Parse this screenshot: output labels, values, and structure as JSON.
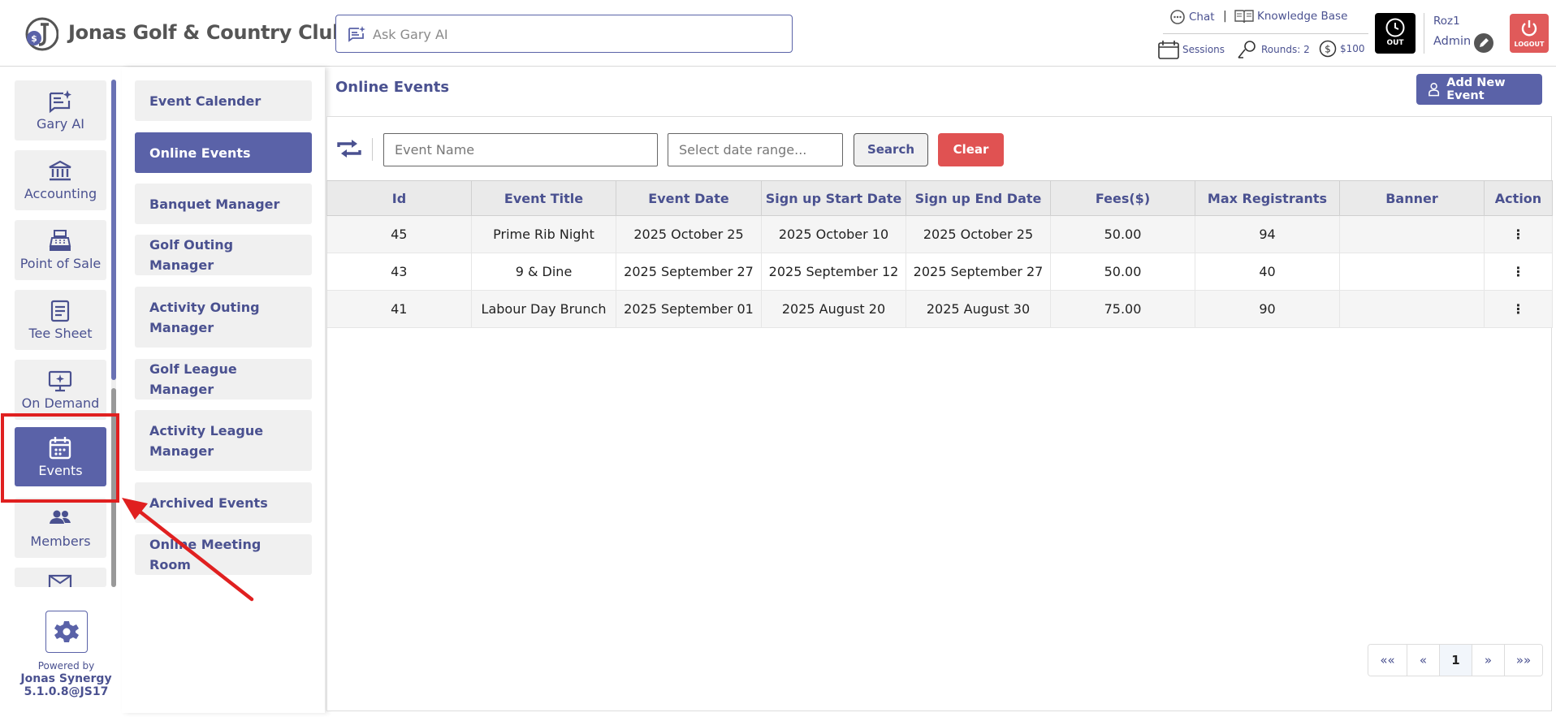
{
  "header": {
    "club_name": "Jonas Golf & Country Club",
    "ask_placeholder": "Ask Gary AI",
    "chat_label": "Chat",
    "separator": "|",
    "knowledge_label": "Knowledge Base",
    "sessions_label": "Sessions",
    "rounds_label": "Rounds: 2",
    "balance_label": "$100",
    "clock_label": "OUT",
    "user_name": "Roz1",
    "user_role": "Admin",
    "logout_label": "LOGOUT"
  },
  "leftnav": {
    "items": [
      {
        "label": "Gary AI",
        "icon": "gary-ai-icon"
      },
      {
        "label": "Accounting",
        "icon": "bank-icon"
      },
      {
        "label": "Point of Sale",
        "icon": "cash-register-icon"
      },
      {
        "label": "Tee Sheet",
        "icon": "document-icon"
      },
      {
        "label": "On Demand",
        "icon": "monitor-sparkle-icon"
      },
      {
        "label": "Events",
        "icon": "calendar-icon",
        "active": true
      },
      {
        "label": "Members",
        "icon": "members-icon"
      }
    ],
    "powered_by": "Powered by",
    "brand": "Jonas Synergy",
    "version": "5.1.0.8@JS17"
  },
  "submenu": {
    "items": [
      {
        "label": "Event Calender"
      },
      {
        "label": "Online Events",
        "active": true
      },
      {
        "label": "Banquet Manager"
      },
      {
        "label": "Golf Outing Manager"
      },
      {
        "label": "Activity Outing Manager"
      },
      {
        "label": "Golf League Manager"
      },
      {
        "label": "Activity League Manager"
      },
      {
        "label": "Archived Events"
      },
      {
        "label": "Online Meeting Room"
      }
    ]
  },
  "main": {
    "title": "Online Events",
    "add_button": "Add New Event",
    "filters": {
      "event_name_placeholder": "Event Name",
      "date_range_placeholder": "Select date range...",
      "search_label": "Search",
      "clear_label": "Clear"
    },
    "table": {
      "columns": [
        "Id",
        "Event Title",
        "Event Date",
        "Sign up Start Date",
        "Sign up End Date",
        "Fees($)",
        "Max Registrants",
        "Banner",
        "Action"
      ],
      "rows": [
        [
          "45",
          "Prime Rib Night",
          "2025 October 25",
          "2025 October 10",
          "2025 October 25",
          "50.00",
          "94",
          "",
          "⋮"
        ],
        [
          "43",
          "9 & Dine",
          "2025 September 27",
          "2025 September 12",
          "2025 September 27",
          "50.00",
          "40",
          "",
          "⋮"
        ],
        [
          "41",
          "Labour Day Brunch",
          "2025 September 01",
          "2025 August 20",
          "2025 August 30",
          "75.00",
          "90",
          "",
          "⋮"
        ]
      ]
    },
    "pagination": {
      "first": "««",
      "prev": "«",
      "current": "1",
      "next": "»",
      "last": "»»"
    }
  },
  "colors": {
    "accent": "#5a62a8",
    "accent_text": "#4a5190",
    "danger": "#e05252",
    "highlight": "#e02020"
  }
}
